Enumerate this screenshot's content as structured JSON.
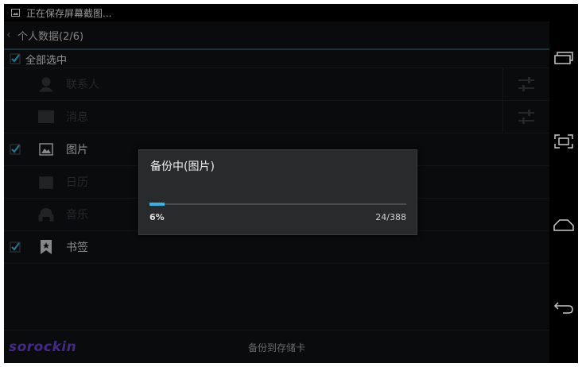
{
  "status_bar": {
    "notification": "正在保存屏幕截图..."
  },
  "action_bar": {
    "title": "个人数据(2/6)"
  },
  "select_all": {
    "label": "全部选中",
    "checked": true
  },
  "items": [
    {
      "label": "联系人",
      "checked": false,
      "dimmed": true,
      "icon": "person-icon",
      "has_settings": true
    },
    {
      "label": "消息",
      "checked": false,
      "dimmed": true,
      "icon": "envelope-icon",
      "has_settings": true
    },
    {
      "label": "图片",
      "checked": true,
      "dimmed": false,
      "icon": "image-icon",
      "has_settings": false
    },
    {
      "label": "日历",
      "checked": false,
      "dimmed": true,
      "icon": "calendar-icon",
      "has_settings": false
    },
    {
      "label": "音乐",
      "checked": false,
      "dimmed": true,
      "icon": "headphones-icon",
      "has_settings": false
    },
    {
      "label": "书签",
      "checked": true,
      "dimmed": false,
      "icon": "bookmark-icon",
      "has_settings": false
    }
  ],
  "bottom_bar": {
    "action": "备份到存储卡"
  },
  "watermark": "sorockin",
  "dialog": {
    "title": "备份中(图片)",
    "percent_label": "6%",
    "progress": 0.06,
    "count": "24/388"
  },
  "colors": {
    "accent": "#33b5e5",
    "watermark": "#6a3fd0"
  }
}
